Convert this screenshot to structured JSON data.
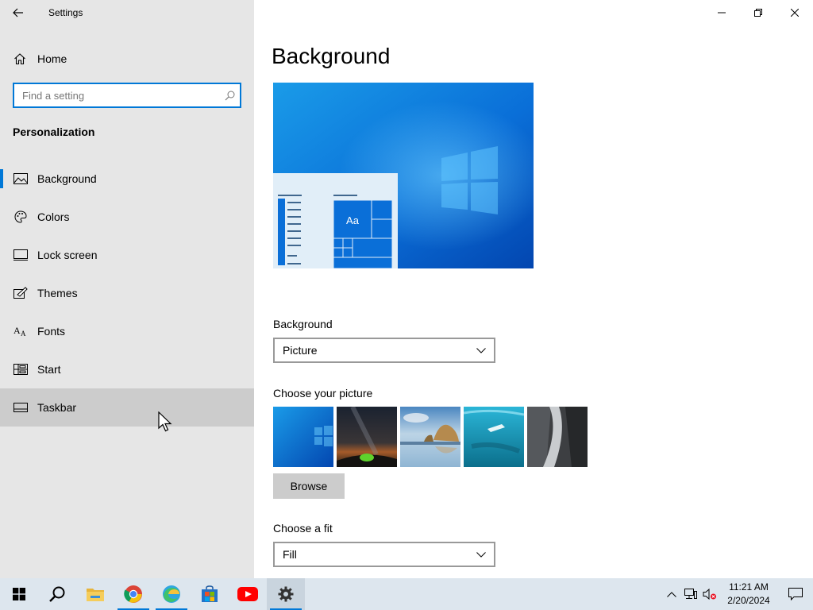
{
  "window": {
    "title": "Settings"
  },
  "sidebar": {
    "home_label": "Home",
    "search_placeholder": "Find a setting",
    "section_title": "Personalization",
    "items": [
      {
        "label": "Background",
        "icon": "picture-icon",
        "selected": true
      },
      {
        "label": "Colors",
        "icon": "palette-icon"
      },
      {
        "label": "Lock screen",
        "icon": "lock-screen-icon"
      },
      {
        "label": "Themes",
        "icon": "themes-icon"
      },
      {
        "label": "Fonts",
        "icon": "fonts-icon"
      },
      {
        "label": "Start",
        "icon": "start-icon"
      },
      {
        "label": "Taskbar",
        "icon": "taskbar-icon",
        "hovered": true
      }
    ]
  },
  "main": {
    "title": "Background",
    "preview_tile_text": "Aa",
    "background_label": "Background",
    "background_value": "Picture",
    "choose_picture_label": "Choose your picture",
    "pictures": [
      "windows-blue-wallpaper",
      "night-sky-tent",
      "beach-rocks",
      "underwater-swimmer",
      "waterfall-rock"
    ],
    "browse_label": "Browse",
    "fit_label": "Choose a fit",
    "fit_value": "Fill"
  },
  "taskbar": {
    "apps": [
      "start-icon",
      "search-icon",
      "file-explorer-icon",
      "chrome-icon",
      "edge-icon",
      "store-icon",
      "youtube-icon",
      "settings-icon"
    ],
    "time": "11:21 AM",
    "date": "2/20/2024"
  },
  "colors": {
    "accent": "#0078d7",
    "sidebar_bg": "#e6e6e6",
    "taskbar_bg": "#dde6ee"
  }
}
